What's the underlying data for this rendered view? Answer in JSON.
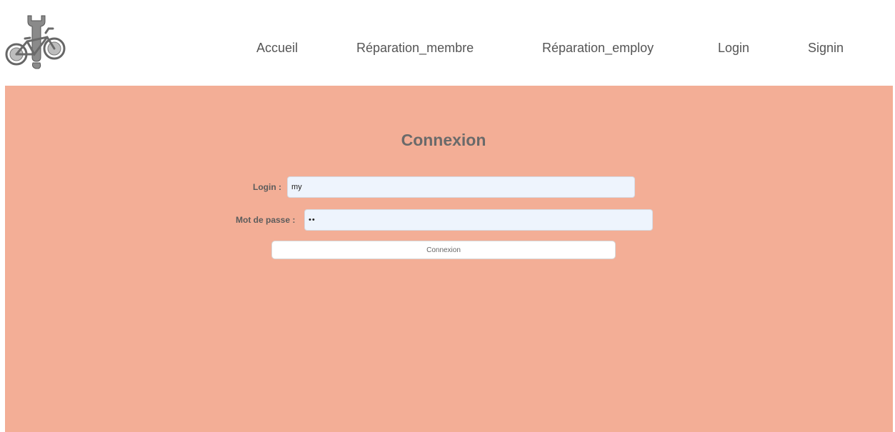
{
  "header": {
    "logo_icon": "bicycle-wrench-logo-icon",
    "nav": {
      "accueil": "Accueil",
      "reparation_membre": "Réparation_membre",
      "reparation_employ": "Réparation_employ",
      "login": "Login",
      "signin": "Signin"
    }
  },
  "login_form": {
    "title": "Connexion",
    "login_label": "Login :",
    "login_value": "my",
    "password_label": "Mot de passe :",
    "password_value": "••",
    "submit_label": "Connexion"
  },
  "colors": {
    "main_background": "#f3ae96",
    "input_background": "#eef4fd",
    "text": "#555555"
  }
}
